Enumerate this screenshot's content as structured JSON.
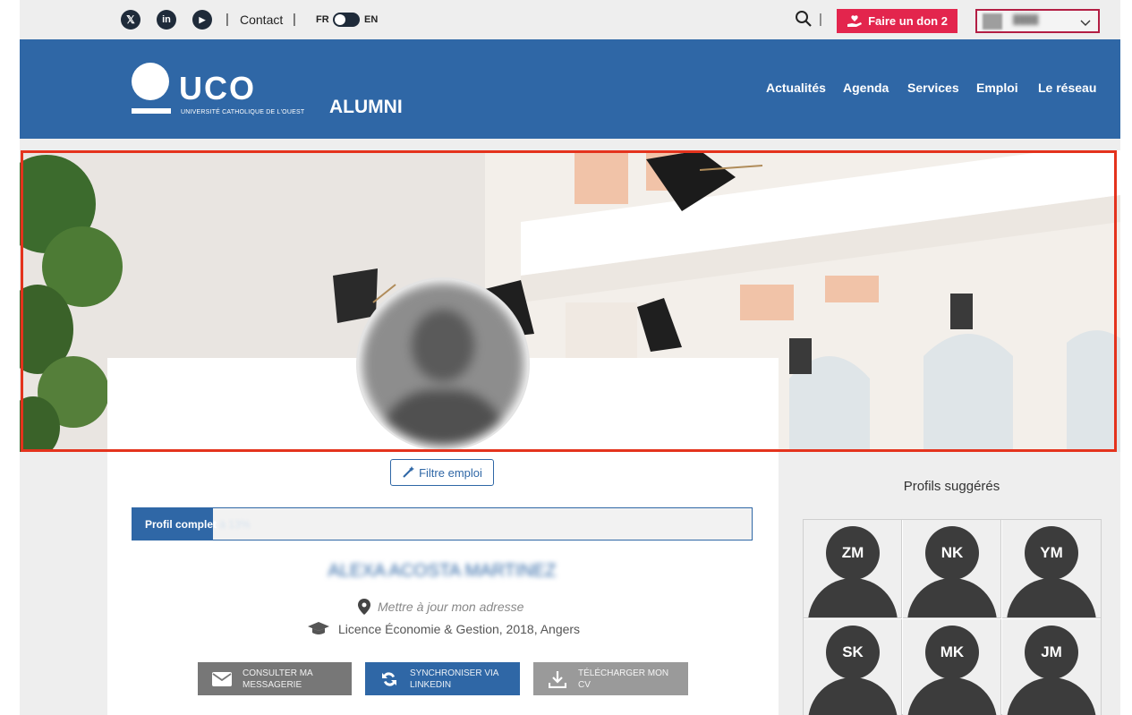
{
  "topbar": {
    "social": [
      {
        "name": "x-twitter",
        "glyph": "𝕏"
      },
      {
        "name": "linkedin",
        "glyph": "in"
      },
      {
        "name": "youtube",
        "glyph": "▶"
      }
    ],
    "contact_label": "Contact",
    "lang_left": "FR",
    "lang_right": "EN",
    "donate_label": "Faire un don 2",
    "donate_color": "#e3254d"
  },
  "header": {
    "logo_text": "UCO",
    "logo_subtitle": "UNIVERSITÉ CATHOLIQUE DE L'OUEST",
    "logo_alumni": "ALUMNI",
    "bg_color": "#2f67a6",
    "nav": [
      "Actualités",
      "Agenda",
      "Services",
      "Emploi",
      "Le réseau"
    ]
  },
  "profile": {
    "filter_label": "Filtre emploi",
    "progress_label": "Profil complet",
    "progress_pct_text": "à 13%",
    "progress_value": 0.13,
    "name": "ALEXA ACOSTA MARTINEZ",
    "address_link": "Mettre à jour mon adresse",
    "education": "Licence Économie & Gestion, 2018, Angers",
    "actions": [
      {
        "line1": "CONSULTER MA",
        "line2": "MESSAGERIE"
      },
      {
        "line1": "SYNCHRONISER VIA",
        "line2": "LINKEDIN"
      },
      {
        "line1": "TÉLÉCHARGER MON",
        "line2": "CV"
      }
    ]
  },
  "suggested": {
    "title": "Profils suggérés",
    "profiles": [
      "ZM",
      "NK",
      "YM",
      "SK",
      "MK",
      "JM"
    ]
  }
}
